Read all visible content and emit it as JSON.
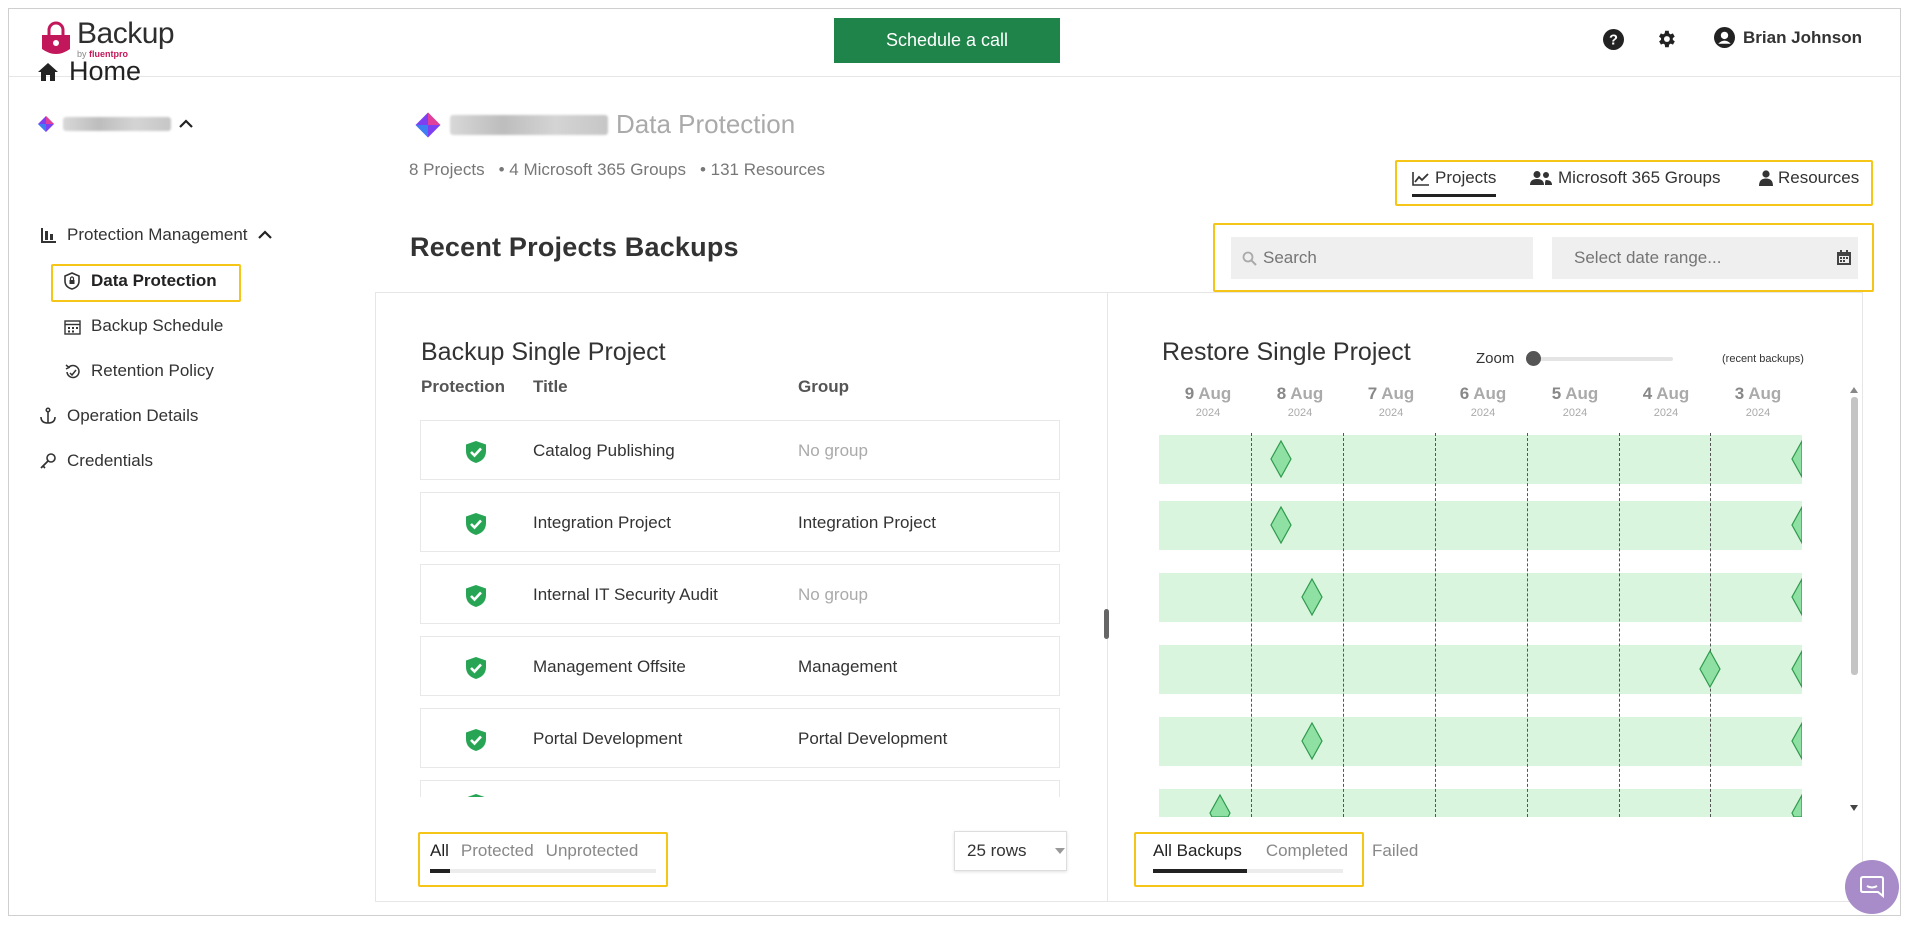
{
  "header": {
    "logo_main": "Backup",
    "logo_by": "by",
    "logo_brand": "fluentpro",
    "schedule_button": "Schedule a call",
    "user_name": "Brian Johnson"
  },
  "sidebar": {
    "home": "Home",
    "protection_management": "Protection Management",
    "data_protection": "Data Protection",
    "backup_schedule": "Backup Schedule",
    "retention_policy": "Retention Policy",
    "operation_details": "Operation Details",
    "credentials": "Credentials"
  },
  "main": {
    "page_title": "Data Protection",
    "stats": {
      "projects": "8 Projects",
      "groups": "• 4 Microsoft 365 Groups",
      "resources": "• 131 Resources"
    },
    "view_tabs": {
      "projects": "Projects",
      "groups": "Microsoft 365 Groups",
      "resources": "Resources"
    },
    "section_title": "Recent Projects Backups",
    "search_placeholder": "Search",
    "date_placeholder": "Select date range..."
  },
  "backup_panel": {
    "title": "Backup Single Project",
    "columns": [
      "Protection",
      "Title",
      "Group"
    ],
    "rows": [
      {
        "title": "Catalog Publishing",
        "group": "No group"
      },
      {
        "title": "Integration Project",
        "group": "Integration Project"
      },
      {
        "title": "Internal IT Security Audit",
        "group": "No group"
      },
      {
        "title": "Management Offsite",
        "group": "Management"
      },
      {
        "title": "Portal Development",
        "group": "Portal Development"
      }
    ],
    "filters": [
      "All",
      "Protected",
      "Unprotected"
    ],
    "rows_select": "25 rows"
  },
  "restore_panel": {
    "title": "Restore Single Project",
    "zoom_label": "Zoom",
    "zoom_level": 0,
    "recent_label": "(recent backups)",
    "dates": [
      {
        "day": "9",
        "month": "Aug",
        "year": "2024"
      },
      {
        "day": "8",
        "month": "Aug",
        "year": "2024"
      },
      {
        "day": "7",
        "month": "Aug",
        "year": "2024"
      },
      {
        "day": "6",
        "month": "Aug",
        "year": "2024"
      },
      {
        "day": "5",
        "month": "Aug",
        "year": "2024"
      },
      {
        "day": "4",
        "month": "Aug",
        "year": "2024"
      },
      {
        "day": "3",
        "month": "Aug",
        "year": "2024"
      }
    ],
    "filters": [
      "All Backups",
      "Completed",
      "Failed"
    ]
  },
  "colors": {
    "accent_green": "#1e8449",
    "highlight": "#f5c518",
    "lane": "#d9f5de",
    "brand_pink": "#c2185b"
  }
}
